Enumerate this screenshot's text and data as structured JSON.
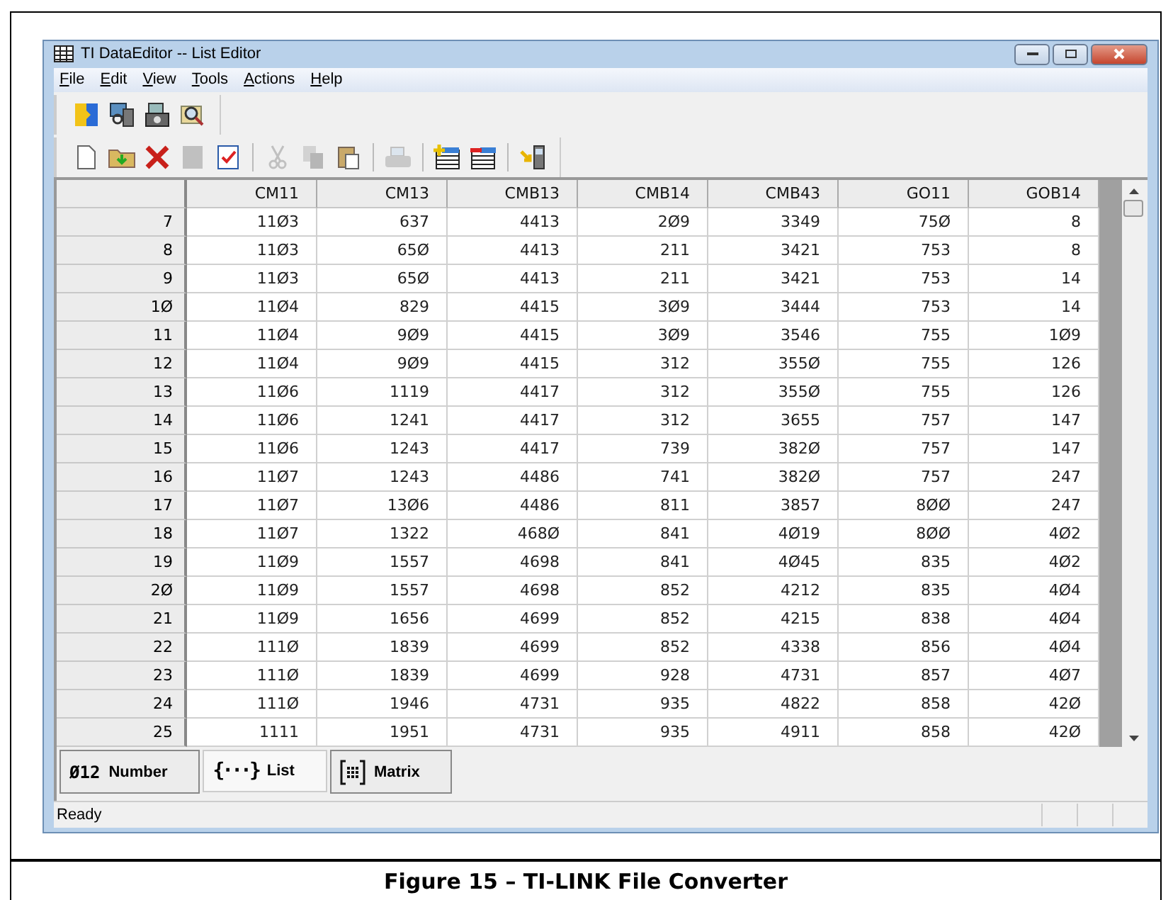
{
  "window": {
    "title": "TI DataEditor -- List Editor"
  },
  "menu": [
    "File",
    "Edit",
    "View",
    "Tools",
    "Actions",
    "Help"
  ],
  "toolbar_top": [
    {
      "kind": "connect",
      "disabled": false
    },
    {
      "kind": "explorer",
      "disabled": false
    },
    {
      "kind": "capture",
      "disabled": false
    },
    {
      "kind": "inspect",
      "disabled": false
    }
  ],
  "toolbar": [
    {
      "kind": "new",
      "disabled": false
    },
    {
      "kind": "open",
      "disabled": false
    },
    {
      "kind": "delete",
      "disabled": false
    },
    {
      "kind": "format",
      "disabled": true
    },
    {
      "kind": "check",
      "disabled": false
    },
    {
      "kind": "sep"
    },
    {
      "kind": "cut",
      "disabled": true
    },
    {
      "kind": "copy",
      "disabled": true
    },
    {
      "kind": "paste",
      "disabled": false
    },
    {
      "kind": "sep"
    },
    {
      "kind": "print",
      "disabled": true
    },
    {
      "kind": "sep"
    },
    {
      "kind": "add-row",
      "disabled": false
    },
    {
      "kind": "remove-row",
      "disabled": false
    },
    {
      "kind": "sep"
    },
    {
      "kind": "send",
      "disabled": false
    }
  ],
  "table": {
    "columns": [
      "CM11",
      "CM13",
      "CMB13",
      "CMB14",
      "CMB43",
      "GO11",
      "GOB14"
    ],
    "rows": [
      {
        "index": "7",
        "cells": [
          "11Ø3",
          "637",
          "4413",
          "2Ø9",
          "3349",
          "75Ø",
          "8"
        ]
      },
      {
        "index": "8",
        "cells": [
          "11Ø3",
          "65Ø",
          "4413",
          "211",
          "3421",
          "753",
          "8"
        ]
      },
      {
        "index": "9",
        "cells": [
          "11Ø3",
          "65Ø",
          "4413",
          "211",
          "3421",
          "753",
          "14"
        ]
      },
      {
        "index": "1Ø",
        "cells": [
          "11Ø4",
          "829",
          "4415",
          "3Ø9",
          "3444",
          "753",
          "14"
        ]
      },
      {
        "index": "11",
        "cells": [
          "11Ø4",
          "9Ø9",
          "4415",
          "3Ø9",
          "3546",
          "755",
          "1Ø9"
        ]
      },
      {
        "index": "12",
        "cells": [
          "11Ø4",
          "9Ø9",
          "4415",
          "312",
          "355Ø",
          "755",
          "126"
        ]
      },
      {
        "index": "13",
        "cells": [
          "11Ø6",
          "1119",
          "4417",
          "312",
          "355Ø",
          "755",
          "126"
        ]
      },
      {
        "index": "14",
        "cells": [
          "11Ø6",
          "1241",
          "4417",
          "312",
          "3655",
          "757",
          "147"
        ]
      },
      {
        "index": "15",
        "cells": [
          "11Ø6",
          "1243",
          "4417",
          "739",
          "382Ø",
          "757",
          "147"
        ]
      },
      {
        "index": "16",
        "cells": [
          "11Ø7",
          "1243",
          "4486",
          "741",
          "382Ø",
          "757",
          "247"
        ]
      },
      {
        "index": "17",
        "cells": [
          "11Ø7",
          "13Ø6",
          "4486",
          "811",
          "3857",
          "8ØØ",
          "247"
        ]
      },
      {
        "index": "18",
        "cells": [
          "11Ø7",
          "1322",
          "468Ø",
          "841",
          "4Ø19",
          "8ØØ",
          "4Ø2"
        ]
      },
      {
        "index": "19",
        "cells": [
          "11Ø9",
          "1557",
          "4698",
          "841",
          "4Ø45",
          "835",
          "4Ø2"
        ]
      },
      {
        "index": "2Ø",
        "cells": [
          "11Ø9",
          "1557",
          "4698",
          "852",
          "4212",
          "835",
          "4Ø4"
        ]
      },
      {
        "index": "21",
        "cells": [
          "11Ø9",
          "1656",
          "4699",
          "852",
          "4215",
          "838",
          "4Ø4"
        ]
      },
      {
        "index": "22",
        "cells": [
          "111Ø",
          "1839",
          "4699",
          "852",
          "4338",
          "856",
          "4Ø4"
        ]
      },
      {
        "index": "23",
        "cells": [
          "111Ø",
          "1839",
          "4699",
          "928",
          "4731",
          "857",
          "4Ø7"
        ]
      },
      {
        "index": "24",
        "cells": [
          "111Ø",
          "1946",
          "4731",
          "935",
          "4822",
          "858",
          "42Ø"
        ]
      },
      {
        "index": "25",
        "cells": [
          "1111",
          "1951",
          "4731",
          "935",
          "4911",
          "858",
          "42Ø"
        ]
      }
    ]
  },
  "tabs": [
    {
      "kind": "number",
      "glyph": "Ø12",
      "label": "Number",
      "selected": false
    },
    {
      "kind": "list",
      "glyph": "{···}",
      "label": "List",
      "selected": true
    },
    {
      "kind": "matrix",
      "label": "Matrix",
      "selected": false
    }
  ],
  "status_bar": {
    "text": "Ready"
  },
  "caption": "Figure 15 – TI-LINK File Converter"
}
